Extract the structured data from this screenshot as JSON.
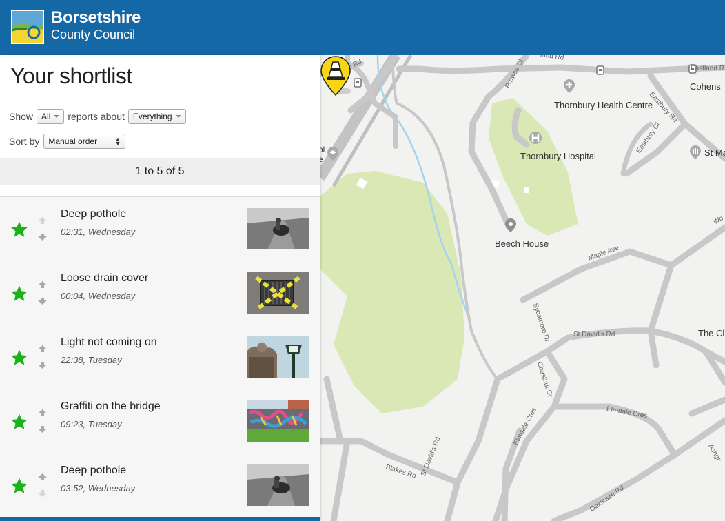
{
  "header": {
    "council_name_line1": "Borsetshire",
    "council_name_line2": "County Council"
  },
  "sidebar": {
    "title": "Your shortlist",
    "show_label": "Show",
    "show_value": "All",
    "reports_about_label": "reports about",
    "category_value": "Everything",
    "sort_label": "Sort by",
    "sort_value": "Manual order",
    "pager_text": "1 to 5 of 5"
  },
  "reports": [
    {
      "title": "Deep pothole",
      "time": "02:31, Wednesday",
      "image": "pothole-photo"
    },
    {
      "title": "Loose drain cover",
      "time": "00:04, Wednesday",
      "image": "drain-cover-photo"
    },
    {
      "title": "Light not coming on",
      "time": "22:38, Tuesday",
      "image": "street-light-photo"
    },
    {
      "title": "Graffiti on the bridge",
      "time": "09:23, Tuesday",
      "image": "graffiti-photo"
    },
    {
      "title": "Deep pothole",
      "time": "03:52, Wednesday",
      "image": "pothole-photo"
    }
  ],
  "map": {
    "places": {
      "health_centre": "Thornbury Health Centre",
      "hospital": "Thornbury Hospital",
      "beech_house": "Beech House",
      "cohens": "Cohens",
      "st_ma": "St Ma",
      "the_cl": "The Cl"
    },
    "roads": {
      "church_rd": "Church Rd",
      "land_rd": "land Rd",
      "prowse_cl": "Prowse Cl",
      "eastland_rd": "Eastland R",
      "eastbury_rd": "Eastbury Rd",
      "eastbury_cl": "Eastbury Cl",
      "maple_ave": "Maple Ave",
      "sycamore_dr": "Sycamore Dr",
      "st_davids_rd_h": "St David's Rd",
      "chestnut_dr": "Chestnut Dr",
      "elmdale_cres_h": "Elmdale Cres",
      "elmdale_cres_v": "Elmdale Cres",
      "st_davids_rd_v": "St David's Rd",
      "blakes_rd": "Blakes Rd",
      "oakleaze_rd": "Oakleaze Rd",
      "ashgr": "Ashgr",
      "wo": "Wo",
      "ol": "ol",
      "e": "e"
    }
  },
  "colors": {
    "brand_blue": "#1568a6",
    "star_green": "#1bb21b",
    "park_green": "#d9e8b5",
    "road_grey": "#c8c8c8",
    "marker_yellow": "#f8d515",
    "stream_blue": "#a4d3ef"
  }
}
